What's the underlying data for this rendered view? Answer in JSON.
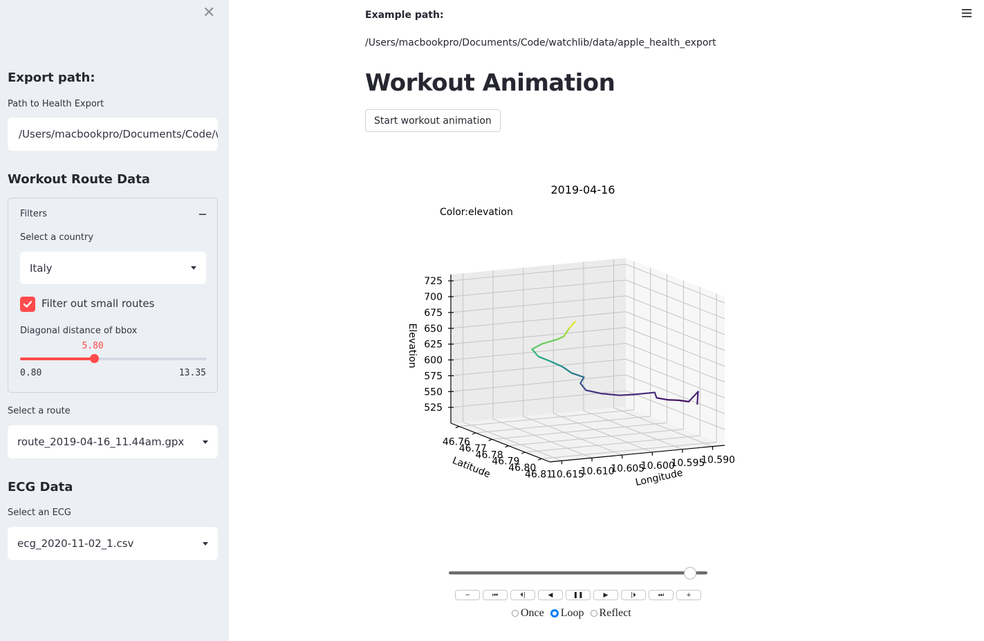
{
  "sidebar": {
    "close_icon": "close-x-icon",
    "export_heading": "Export path:",
    "path_label": "Path to Health Export",
    "path_value": "/Users/macbookpro/Documents/Code/w",
    "route_heading": "Workout Route Data",
    "filters": {
      "title": "Filters",
      "country_label": "Select a country",
      "country_value": "Italy",
      "checkbox_label": "Filter out small routes",
      "checkbox_checked": true,
      "slider_label": "Diagonal distance of bbox",
      "slider_value": "5.80",
      "slider_min": "0.80",
      "slider_max": "13.35",
      "slider_fraction": 0.398
    },
    "route_label": "Select a route",
    "route_value": "route_2019-04-16_11.44am.gpx",
    "ecg_heading": "ECG Data",
    "ecg_label": "Select an ECG",
    "ecg_value": "ecg_2020-11-02_1.csv"
  },
  "main": {
    "example_label": "Example path:",
    "example_path": "/Users/macbookpro/Documents/Code/watchlib/data/apple_health_export",
    "title": "Workout Animation",
    "start_button": "Start workout animation",
    "menu_icon": "hamburger-icon"
  },
  "chart_data": {
    "type": "line3d",
    "title": "2019-04-16",
    "annotation": "Color:elevation",
    "xlabel": "Longitude",
    "ylabel": "Latitude",
    "zlabel": "Elevation",
    "x_ticks": [
      "10.615",
      "10.610",
      "10.605",
      "10.600",
      "10.595",
      "10.590"
    ],
    "y_ticks": [
      "46.76",
      "46.77",
      "46.78",
      "46.79",
      "46.80",
      "46.81"
    ],
    "z_ticks": [
      "525",
      "550",
      "575",
      "600",
      "625",
      "650",
      "675",
      "700",
      "725"
    ],
    "xlim": [
      10.588,
      10.617
    ],
    "ylim": [
      46.755,
      46.815
    ],
    "zlim": [
      500,
      735
    ],
    "colormap": "viridis",
    "route": [
      {
        "lon": 10.5905,
        "lat": 46.8075,
        "ele": 560
      },
      {
        "lon": 10.5905,
        "lat": 46.808,
        "ele": 580
      },
      {
        "lon": 10.5915,
        "lat": 46.806,
        "ele": 563
      },
      {
        "lon": 10.593,
        "lat": 46.8055,
        "ele": 566
      },
      {
        "lon": 10.5945,
        "lat": 46.8045,
        "ele": 567
      },
      {
        "lon": 10.596,
        "lat": 46.803,
        "ele": 570
      },
      {
        "lon": 10.5955,
        "lat": 46.8,
        "ele": 575
      },
      {
        "lon": 10.5985,
        "lat": 46.7985,
        "ele": 573
      },
      {
        "lon": 10.6005,
        "lat": 46.797,
        "ele": 572
      },
      {
        "lon": 10.603,
        "lat": 46.795,
        "ele": 575
      },
      {
        "lon": 10.605,
        "lat": 46.793,
        "ele": 580
      },
      {
        "lon": 10.6055,
        "lat": 46.7915,
        "ele": 590
      },
      {
        "lon": 10.6045,
        "lat": 46.79,
        "ele": 597
      },
      {
        "lon": 10.606,
        "lat": 46.788,
        "ele": 603
      },
      {
        "lon": 10.607,
        "lat": 46.786,
        "ele": 612
      },
      {
        "lon": 10.6085,
        "lat": 46.784,
        "ele": 620
      },
      {
        "lon": 10.61,
        "lat": 46.7825,
        "ele": 627
      },
      {
        "lon": 10.6105,
        "lat": 46.7805,
        "ele": 637
      },
      {
        "lon": 10.6085,
        "lat": 46.779,
        "ele": 642
      },
      {
        "lon": 10.6055,
        "lat": 46.7775,
        "ele": 645
      },
      {
        "lon": 10.604,
        "lat": 46.776,
        "ele": 647
      },
      {
        "lon": 10.603,
        "lat": 46.7755,
        "ele": 658
      },
      {
        "lon": 10.602,
        "lat": 46.7755,
        "ele": 668
      }
    ]
  },
  "animation_controls": {
    "progress_fraction": 0.93,
    "buttons": [
      {
        "name": "decrease-speed",
        "glyph": "−"
      },
      {
        "name": "first-frame",
        "glyph": "⏮"
      },
      {
        "name": "previous-frame",
        "glyph": "⏴|"
      },
      {
        "name": "play-reverse",
        "glyph": "◀"
      },
      {
        "name": "pause",
        "glyph": "❚❚"
      },
      {
        "name": "play",
        "glyph": "▶"
      },
      {
        "name": "next-frame",
        "glyph": "|⏵"
      },
      {
        "name": "last-frame",
        "glyph": "⏭"
      },
      {
        "name": "increase-speed",
        "glyph": "+"
      }
    ],
    "modes": [
      {
        "label": "Once",
        "selected": false
      },
      {
        "label": "Loop",
        "selected": true
      },
      {
        "label": "Reflect",
        "selected": false
      }
    ]
  }
}
